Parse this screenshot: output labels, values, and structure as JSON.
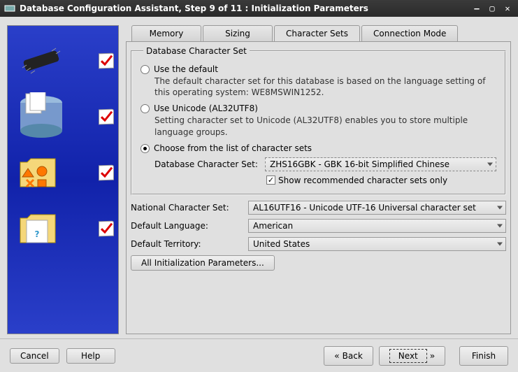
{
  "window": {
    "title": "Database Configuration Assistant, Step 9 of 11 : Initialization Parameters"
  },
  "tabs": {
    "memory": "Memory",
    "sizing": "Sizing",
    "charsets": "Character Sets",
    "connmode": "Connection Mode"
  },
  "fieldset": {
    "legend": "Database Character Set",
    "opt_default_label": "Use the default",
    "opt_default_desc": "The default character set for this database is based on the language setting of this operating system: WE8MSWIN1252.",
    "opt_unicode_label": "Use Unicode (AL32UTF8)",
    "opt_unicode_desc": "Setting character set to Unicode (AL32UTF8) enables you to store multiple language groups.",
    "opt_choose_label": "Choose from the list of character sets",
    "db_charset_label": "Database Character Set:",
    "db_charset_value": "ZHS16GBK - GBK 16-bit Simplified Chinese",
    "show_recommended": "Show recommended character sets only"
  },
  "lower": {
    "nat_charset_label": "National Character Set:",
    "nat_charset_value": "AL16UTF16 - Unicode UTF-16 Universal character set",
    "def_lang_label": "Default Language:",
    "def_lang_value": "American",
    "def_terr_label": "Default Territory:",
    "def_terr_value": "United States"
  },
  "buttons": {
    "all_params": "All Initialization Parameters...",
    "cancel": "Cancel",
    "help": "Help",
    "back": "Back",
    "next": "Next",
    "finish": "Finish"
  }
}
